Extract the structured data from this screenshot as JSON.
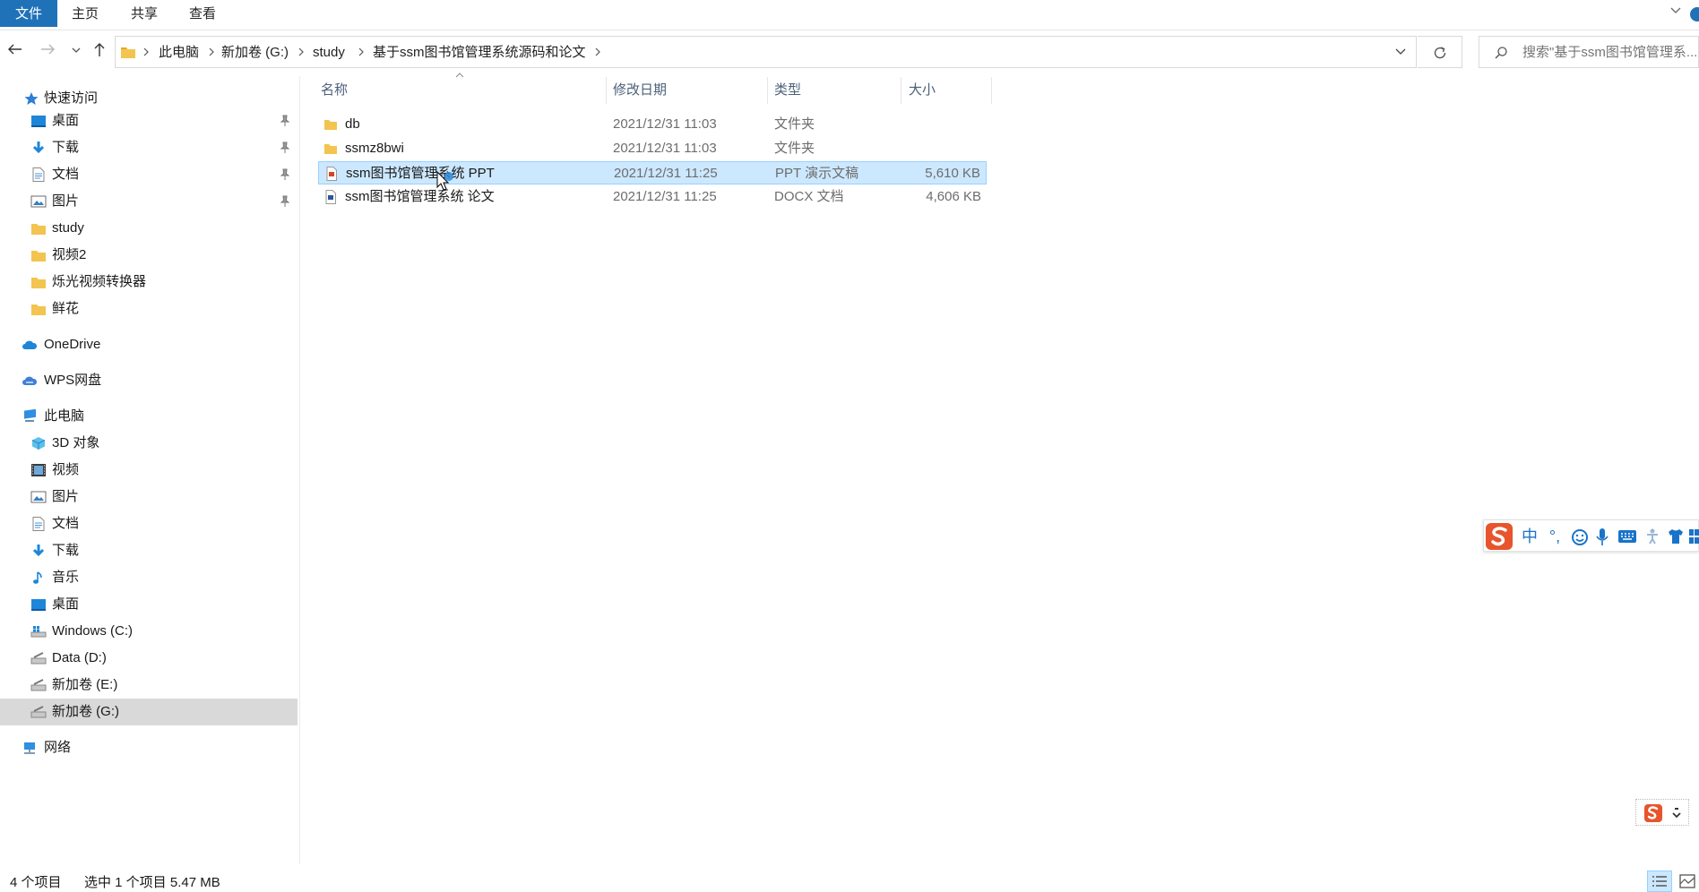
{
  "ribbon": {
    "tabs": [
      "文件",
      "主页",
      "共享",
      "查看"
    ]
  },
  "address": {
    "crumbs": [
      "此电脑",
      "新加卷 (G:)",
      "study",
      "基于ssm图书馆管理系统源码和论文"
    ]
  },
  "search": {
    "placeholder": "搜索\"基于ssm图书馆管理系..."
  },
  "sidebar": {
    "quick_access": "快速访问",
    "quick_items": [
      {
        "label": "桌面",
        "icon": "desktop-icon",
        "pinned": true
      },
      {
        "label": "下载",
        "icon": "download-icon",
        "pinned": true
      },
      {
        "label": "文档",
        "icon": "document-icon",
        "pinned": true
      },
      {
        "label": "图片",
        "icon": "picture-icon",
        "pinned": true
      },
      {
        "label": "study",
        "icon": "folder-icon",
        "pinned": false
      },
      {
        "label": "视频2",
        "icon": "folder-icon",
        "pinned": false
      },
      {
        "label": "烁光视频转换器",
        "icon": "folder-icon",
        "pinned": false
      },
      {
        "label": "鲜花",
        "icon": "folder-icon",
        "pinned": false
      }
    ],
    "onedrive": "OneDrive",
    "wps": "WPS网盘",
    "this_pc": "此电脑",
    "pc_items": [
      {
        "label": "3D 对象",
        "icon": "3d-objects-icon"
      },
      {
        "label": "视频",
        "icon": "video-icon"
      },
      {
        "label": "图片",
        "icon": "picture-icon"
      },
      {
        "label": "文档",
        "icon": "document-icon"
      },
      {
        "label": "下载",
        "icon": "download-icon"
      },
      {
        "label": "音乐",
        "icon": "music-icon"
      },
      {
        "label": "桌面",
        "icon": "desktop-icon"
      },
      {
        "label": "Windows (C:)",
        "icon": "drive-icon"
      },
      {
        "label": "Data (D:)",
        "icon": "drive-icon"
      },
      {
        "label": "新加卷 (E:)",
        "icon": "drive-icon"
      },
      {
        "label": "新加卷 (G:)",
        "icon": "drive-icon",
        "selected": true
      }
    ],
    "network": "网络"
  },
  "columns": {
    "name": "名称",
    "date": "修改日期",
    "type": "类型",
    "size": "大小"
  },
  "files": [
    {
      "name": "db",
      "date": "2021/12/31 11:03",
      "type": "文件夹",
      "size": "",
      "icon": "folder-icon"
    },
    {
      "name": "ssmz8bwi",
      "date": "2021/12/31 11:03",
      "type": "文件夹",
      "size": "",
      "icon": "folder-icon"
    },
    {
      "name": "ssm图书馆管理系统  PPT",
      "date": "2021/12/31 11:25",
      "type": "PPT 演示文稿",
      "size": "5,610 KB",
      "icon": "ppt-file-icon",
      "selected": true
    },
    {
      "name": "ssm图书馆管理系统  论文",
      "date": "2021/12/31 11:25",
      "type": "DOCX 文档",
      "size": "4,606 KB",
      "icon": "docx-file-icon"
    }
  ],
  "status": {
    "count": "4 个项目",
    "selection": "选中 1 个项目  5.47 MB"
  },
  "ime": {
    "mode": "中",
    "punct": "°,"
  },
  "colors": {
    "accent": "#1f72b8",
    "selected_row": "#cce8ff",
    "selected_sidebar": "#d9d9d9",
    "sogou": "#e8542b"
  }
}
